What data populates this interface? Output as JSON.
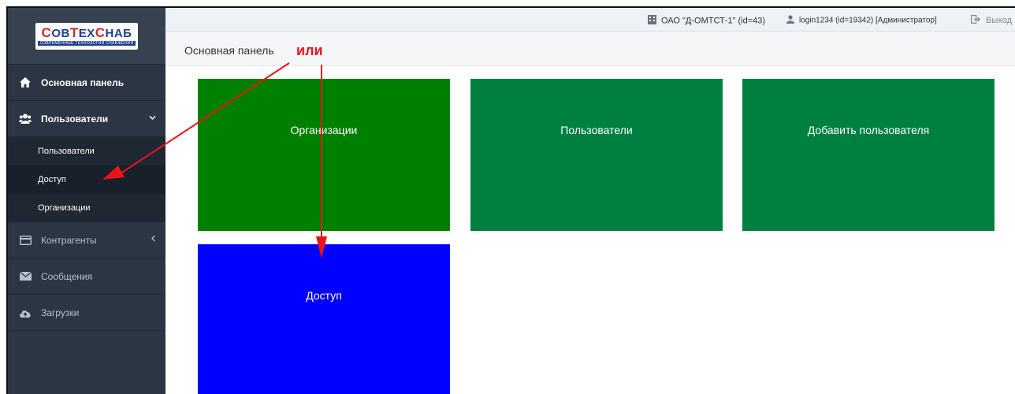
{
  "app": {
    "logo_text_parts": [
      "С",
      "ОВ",
      "Т",
      "ЕХ",
      "С",
      "НАБ"
    ],
    "logo_subtitle": "СОВРЕМЕННЫЕ ТЕХНОЛОГИИ СНАБЖЕНИЯ"
  },
  "topbar": {
    "org": "ОАО \"Д-ОМТСТ-1\" (id=43)",
    "user": "login1234 (id=19342) [Администратор]",
    "logout": "Выход"
  },
  "header": {
    "title": "Основная панель"
  },
  "sidebar": {
    "items": [
      {
        "label": "Основная панель",
        "icon": "home-icon"
      },
      {
        "label": "Пользователи",
        "icon": "users-icon",
        "expanded": true,
        "children": [
          {
            "label": "Пользователи"
          },
          {
            "label": "Доступ",
            "active": true
          },
          {
            "label": "Организации"
          }
        ]
      },
      {
        "label": "Контрагенты",
        "icon": "card-icon"
      },
      {
        "label": "Сообщения",
        "icon": "envelope-icon"
      },
      {
        "label": "Загрузки",
        "icon": "cloud-upload-icon"
      }
    ]
  },
  "tiles": [
    {
      "label": "Организации",
      "color": "#008000"
    },
    {
      "label": "Пользователи",
      "color": "#008040"
    },
    {
      "label": "Добавить пользователя",
      "color": "#008040"
    },
    {
      "label": "Доступ",
      "color": "#0000ff"
    }
  ],
  "annotation": {
    "text": "или",
    "color": "#e8141a"
  }
}
